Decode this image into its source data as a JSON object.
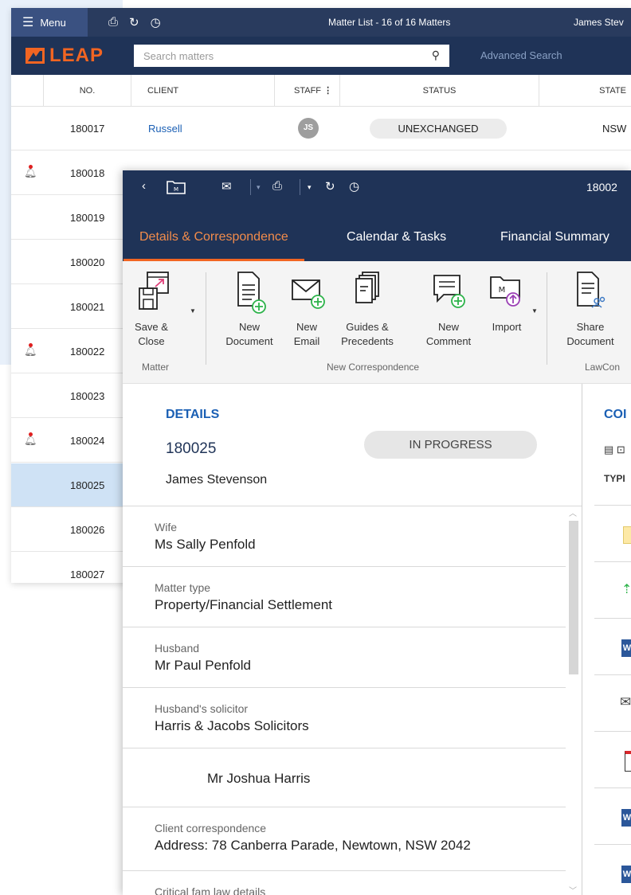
{
  "list_window": {
    "menu_label": "Menu",
    "title": "Matter List - 16 of 16 Matters",
    "user": "James Stev",
    "brand": "LEAP",
    "search_placeholder": "Search matters",
    "advanced_search": "Advanced Search",
    "columns": [
      "NO.",
      "CLIENT",
      "STAFF",
      "STATUS",
      "STATE"
    ],
    "rows": [
      {
        "no": "180017",
        "client": "Russell",
        "staff": "JS",
        "status": "UNEXCHANGED",
        "state": "NSW",
        "alert": false
      },
      {
        "no": "180018",
        "alert": true
      },
      {
        "no": "180019",
        "alert": false
      },
      {
        "no": "180020",
        "alert": false
      },
      {
        "no": "180021",
        "alert": false
      },
      {
        "no": "180022",
        "alert": true
      },
      {
        "no": "180023",
        "alert": false
      },
      {
        "no": "180024",
        "alert": true
      },
      {
        "no": "180025",
        "alert": false,
        "selected": true
      },
      {
        "no": "180026",
        "alert": false
      },
      {
        "no": "180027",
        "alert": false
      }
    ]
  },
  "detail_window": {
    "matter_number": "18002",
    "tabs": [
      "Details & Correspondence",
      "Calendar & Tasks",
      "Financial Summary"
    ],
    "ribbon": {
      "save_close": "Save &\nClose",
      "new_document": "New\nDocument",
      "new_email": "New\nEmail",
      "guides": "Guides &\nPrecedents",
      "new_comment": "New\nComment",
      "import": "Import",
      "share_document": "Share\nDocument",
      "group_matter": "Matter",
      "group_new_corr": "New Correspondence",
      "group_lawconnect": "LawCon"
    },
    "details": {
      "heading": "DETAILS",
      "number": "180025",
      "status": "IN PROGRESS",
      "client": "James Stevenson",
      "fields": [
        {
          "label": "Wife",
          "value": "Ms Sally Penfold"
        },
        {
          "label": "Matter type",
          "value": "Property/Financial Settlement"
        },
        {
          "label": "Husband",
          "value": "Mr Paul Penfold"
        },
        {
          "label": "Husband's solicitor",
          "value": "Harris & Jacobs Solicitors"
        },
        {
          "label": "",
          "value": "Mr Joshua Harris"
        },
        {
          "label": "Client correspondence",
          "value": "Address: 78 Canberra Parade, Newtown, NSW 2042"
        },
        {
          "label": "Critical fam law details",
          "value": ""
        }
      ]
    },
    "correspondence": {
      "heading": "COI",
      "type_col": "TYPI"
    }
  },
  "colors": {
    "navy": "#1f3357",
    "orange": "#f26522",
    "link_blue": "#1a5fb4",
    "selected_row": "#cfe2f5"
  }
}
